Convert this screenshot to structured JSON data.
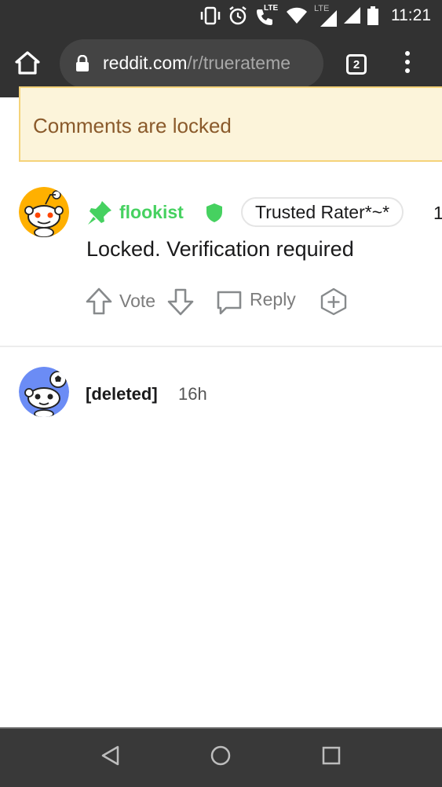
{
  "status_bar": {
    "time": "11:21",
    "lte_call": "LTE",
    "lte_signal": "LTE"
  },
  "browser": {
    "url_domain": "reddit.com",
    "url_path": "/r/truerateme",
    "tab_count": "2"
  },
  "banner": {
    "text": "Comments are locked"
  },
  "comments": [
    {
      "username": "flookist",
      "flair": "Trusted Rater*~*",
      "overflow_text": "1",
      "body": "Locked. Verification required",
      "vote_label": "Vote",
      "reply_label": "Reply"
    },
    {
      "username": "[deleted]",
      "time": "16h"
    }
  ],
  "colors": {
    "status_bar_bg": "#323232",
    "username_green": "#46d160",
    "banner_bg": "#fcf4da",
    "banner_border": "#f5d37a",
    "banner_text": "#8a5a2b",
    "avatar1_bg": "#ffb000",
    "avatar2_bg": "#6b8cf5"
  },
  "icons": [
    "vibrate-icon",
    "alarm-icon",
    "wifi-call-icon",
    "wifi-icon",
    "signal-icon",
    "battery-icon",
    "home-icon",
    "lock-icon",
    "tabs-icon",
    "menu-icon",
    "pin-icon",
    "shield-icon",
    "upvote-icon",
    "downvote-icon",
    "reply-icon",
    "award-icon",
    "back-icon",
    "home-nav-icon",
    "recents-icon"
  ]
}
